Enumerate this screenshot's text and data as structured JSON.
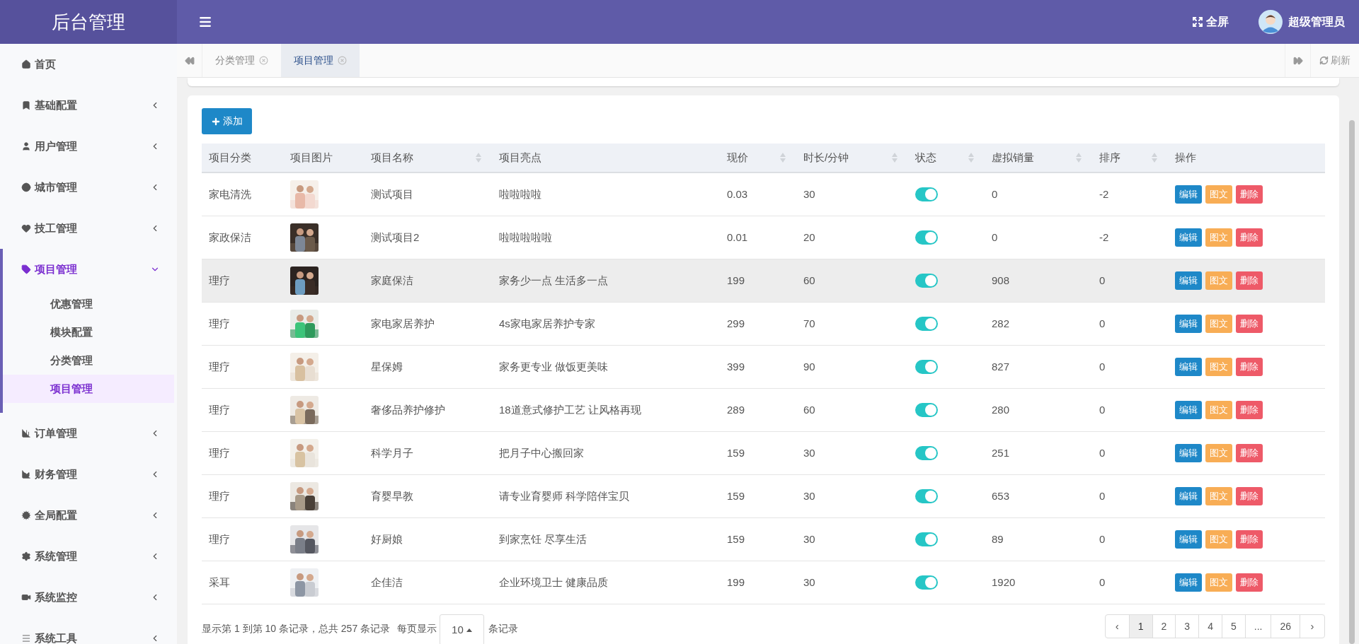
{
  "brand": "后台管理",
  "header": {
    "fullscreen_label": "全屏",
    "user_name": "超级管理员"
  },
  "sidebar": {
    "items": [
      {
        "label": "首页",
        "selected": false
      },
      {
        "label": "基础配置",
        "selected": false,
        "expanded": false
      },
      {
        "label": "用户管理",
        "selected": false,
        "expanded": false
      },
      {
        "label": "城市管理",
        "selected": false,
        "expanded": false
      },
      {
        "label": "技工管理",
        "selected": false,
        "expanded": false
      },
      {
        "label": "项目管理",
        "selected": true,
        "expanded": true,
        "children": [
          {
            "label": "优惠管理",
            "selected": false
          },
          {
            "label": "模块配置",
            "selected": false
          },
          {
            "label": "分类管理",
            "selected": false
          },
          {
            "label": "项目管理",
            "selected": true
          }
        ]
      },
      {
        "label": "订单管理",
        "selected": false,
        "expanded": false
      },
      {
        "label": "财务管理",
        "selected": false,
        "expanded": false
      },
      {
        "label": "全局配置",
        "selected": false,
        "expanded": false
      },
      {
        "label": "系统管理",
        "selected": false,
        "expanded": false
      },
      {
        "label": "系统监控",
        "selected": false,
        "expanded": false
      },
      {
        "label": "系统工具",
        "selected": false,
        "expanded": false
      }
    ]
  },
  "tabs": [
    {
      "label": "分类管理",
      "selected": false
    },
    {
      "label": "项目管理",
      "selected": true
    }
  ],
  "refresh_label": "刷新",
  "add_button": "添加",
  "table": {
    "columns": [
      {
        "label": "项目分类",
        "sortable": false
      },
      {
        "label": "项目图片",
        "sortable": false
      },
      {
        "label": "项目名称",
        "sortable": true
      },
      {
        "label": "项目亮点",
        "sortable": false
      },
      {
        "label": "现价",
        "sortable": true
      },
      {
        "label": "时长/分钟",
        "sortable": true
      },
      {
        "label": "状态",
        "sortable": true
      },
      {
        "label": "虚拟销量",
        "sortable": true
      },
      {
        "label": "排序",
        "sortable": true
      },
      {
        "label": "操作",
        "sortable": false
      }
    ],
    "rows": [
      {
        "category": "家电清洗",
        "name": "测试项目",
        "highlight": "啦啦啦啦",
        "price": "0.03",
        "duration": "30",
        "enabled": true,
        "sales": "0",
        "order": "-2",
        "selected": false,
        "actions": [
          {
            "label": "编辑",
            "kind": "edit"
          },
          {
            "label": "图文",
            "kind": "content"
          },
          {
            "label": "删除",
            "kind": "delete"
          }
        ]
      },
      {
        "category": "家政保洁",
        "name": "测试项目2",
        "highlight": "啦啦啦啦啦",
        "price": "0.01",
        "duration": "20",
        "enabled": true,
        "sales": "0",
        "order": "-2",
        "selected": false,
        "actions": [
          {
            "label": "编辑",
            "kind": "edit"
          },
          {
            "label": "图文",
            "kind": "content"
          },
          {
            "label": "删除",
            "kind": "delete"
          }
        ]
      },
      {
        "category": "理疗",
        "name": "家庭保洁",
        "highlight": "家务少一点 生活多一点",
        "price": "199",
        "duration": "60",
        "enabled": true,
        "sales": "908",
        "order": "0",
        "selected": true,
        "actions": [
          {
            "label": "编辑",
            "kind": "edit"
          },
          {
            "label": "图文",
            "kind": "content"
          },
          {
            "label": "删除",
            "kind": "delete"
          }
        ]
      },
      {
        "category": "理疗",
        "name": "家电家居养护",
        "highlight": "4s家电家居养护专家",
        "price": "299",
        "duration": "70",
        "enabled": true,
        "sales": "282",
        "order": "0",
        "selected": false,
        "actions": [
          {
            "label": "编辑",
            "kind": "edit"
          },
          {
            "label": "图文",
            "kind": "content"
          },
          {
            "label": "删除",
            "kind": "delete"
          }
        ]
      },
      {
        "category": "理疗",
        "name": "星保姆",
        "highlight": "家务更专业 做饭更美味",
        "price": "399",
        "duration": "90",
        "enabled": true,
        "sales": "827",
        "order": "0",
        "selected": false,
        "actions": [
          {
            "label": "编辑",
            "kind": "edit"
          },
          {
            "label": "图文",
            "kind": "content"
          },
          {
            "label": "删除",
            "kind": "delete"
          }
        ]
      },
      {
        "category": "理疗",
        "name": "奢侈品养护修护",
        "highlight": "18道意式修护工艺 让风格再现",
        "price": "289",
        "duration": "60",
        "enabled": true,
        "sales": "280",
        "order": "0",
        "selected": false,
        "actions": [
          {
            "label": "编辑",
            "kind": "edit"
          },
          {
            "label": "图文",
            "kind": "content"
          },
          {
            "label": "删除",
            "kind": "delete"
          }
        ]
      },
      {
        "category": "理疗",
        "name": "科学月子",
        "highlight": "把月子中心搬回家",
        "price": "159",
        "duration": "30",
        "enabled": true,
        "sales": "251",
        "order": "0",
        "selected": false,
        "actions": [
          {
            "label": "编辑",
            "kind": "edit"
          },
          {
            "label": "图文",
            "kind": "content"
          },
          {
            "label": "删除",
            "kind": "delete"
          }
        ]
      },
      {
        "category": "理疗",
        "name": "育婴早教",
        "highlight": "请专业育婴师 科学陪伴宝贝",
        "price": "159",
        "duration": "30",
        "enabled": true,
        "sales": "653",
        "order": "0",
        "selected": false,
        "actions": [
          {
            "label": "编辑",
            "kind": "edit"
          },
          {
            "label": "图文",
            "kind": "content"
          },
          {
            "label": "删除",
            "kind": "delete"
          }
        ]
      },
      {
        "category": "理疗",
        "name": "好厨娘",
        "highlight": "到家烹饪 尽享生活",
        "price": "159",
        "duration": "30",
        "enabled": true,
        "sales": "89",
        "order": "0",
        "selected": false,
        "actions": [
          {
            "label": "编辑",
            "kind": "edit"
          },
          {
            "label": "图文",
            "kind": "content"
          },
          {
            "label": "删除",
            "kind": "delete"
          }
        ]
      },
      {
        "category": "采耳",
        "name": "企佳洁",
        "highlight": "企业环境卫士 健康品质",
        "price": "199",
        "duration": "30",
        "enabled": true,
        "sales": "1920",
        "order": "0",
        "selected": false,
        "actions": [
          {
            "label": "编辑",
            "kind": "edit"
          },
          {
            "label": "图文",
            "kind": "content"
          },
          {
            "label": "删除",
            "kind": "delete"
          }
        ]
      }
    ]
  },
  "pagination": {
    "summary": "显示第 1 到第 10 条记录，总共 257 条记录",
    "per_page_prefix": "每页显示",
    "per_page": "10",
    "per_page_suffix": "条记录",
    "prev": "‹",
    "next": "›",
    "pages": [
      {
        "label": "1",
        "selected": true
      },
      {
        "label": "2",
        "selected": false
      },
      {
        "label": "3",
        "selected": false
      },
      {
        "label": "4",
        "selected": false
      },
      {
        "label": "5",
        "selected": false
      },
      {
        "label": "...",
        "selected": false
      },
      {
        "label": "26",
        "selected": false
      }
    ]
  }
}
